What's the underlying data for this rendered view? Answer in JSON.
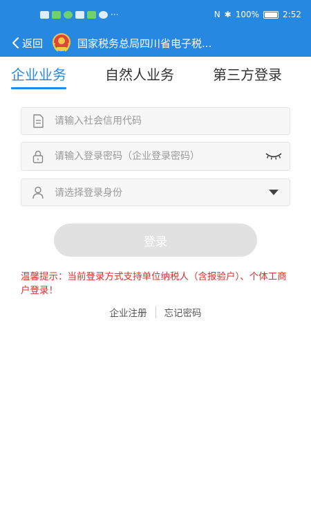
{
  "status_bar": {
    "battery": "100%",
    "time": "2:52"
  },
  "header": {
    "back_label": "返回",
    "title": "国家税务总局四川省电子税..."
  },
  "tabs": [
    {
      "label": "企业业务",
      "active": true
    },
    {
      "label": "自然人业务",
      "active": false
    },
    {
      "label": "第三方登录",
      "active": false
    }
  ],
  "form": {
    "credit_code_placeholder": "请输入社会信用代码",
    "password_placeholder": "请输入登录密码（企业登录密码）",
    "identity_placeholder": "请选择登录身份",
    "login_label": "登录"
  },
  "tip": "温馨提示：当前登录方式支持单位纳税人（含报验户）、个体工商户登录！",
  "links": {
    "register": "企业注册",
    "forgot": "忘记密码"
  },
  "colors": {
    "primary": "#2688e0",
    "tip": "#d9302c",
    "button_disabled": "#e1e1e1"
  },
  "icons": [
    "back-arrow-icon",
    "tax-emblem-icon",
    "document-icon",
    "lock-icon",
    "eye-closed-icon",
    "user-icon",
    "caret-down-icon"
  ]
}
